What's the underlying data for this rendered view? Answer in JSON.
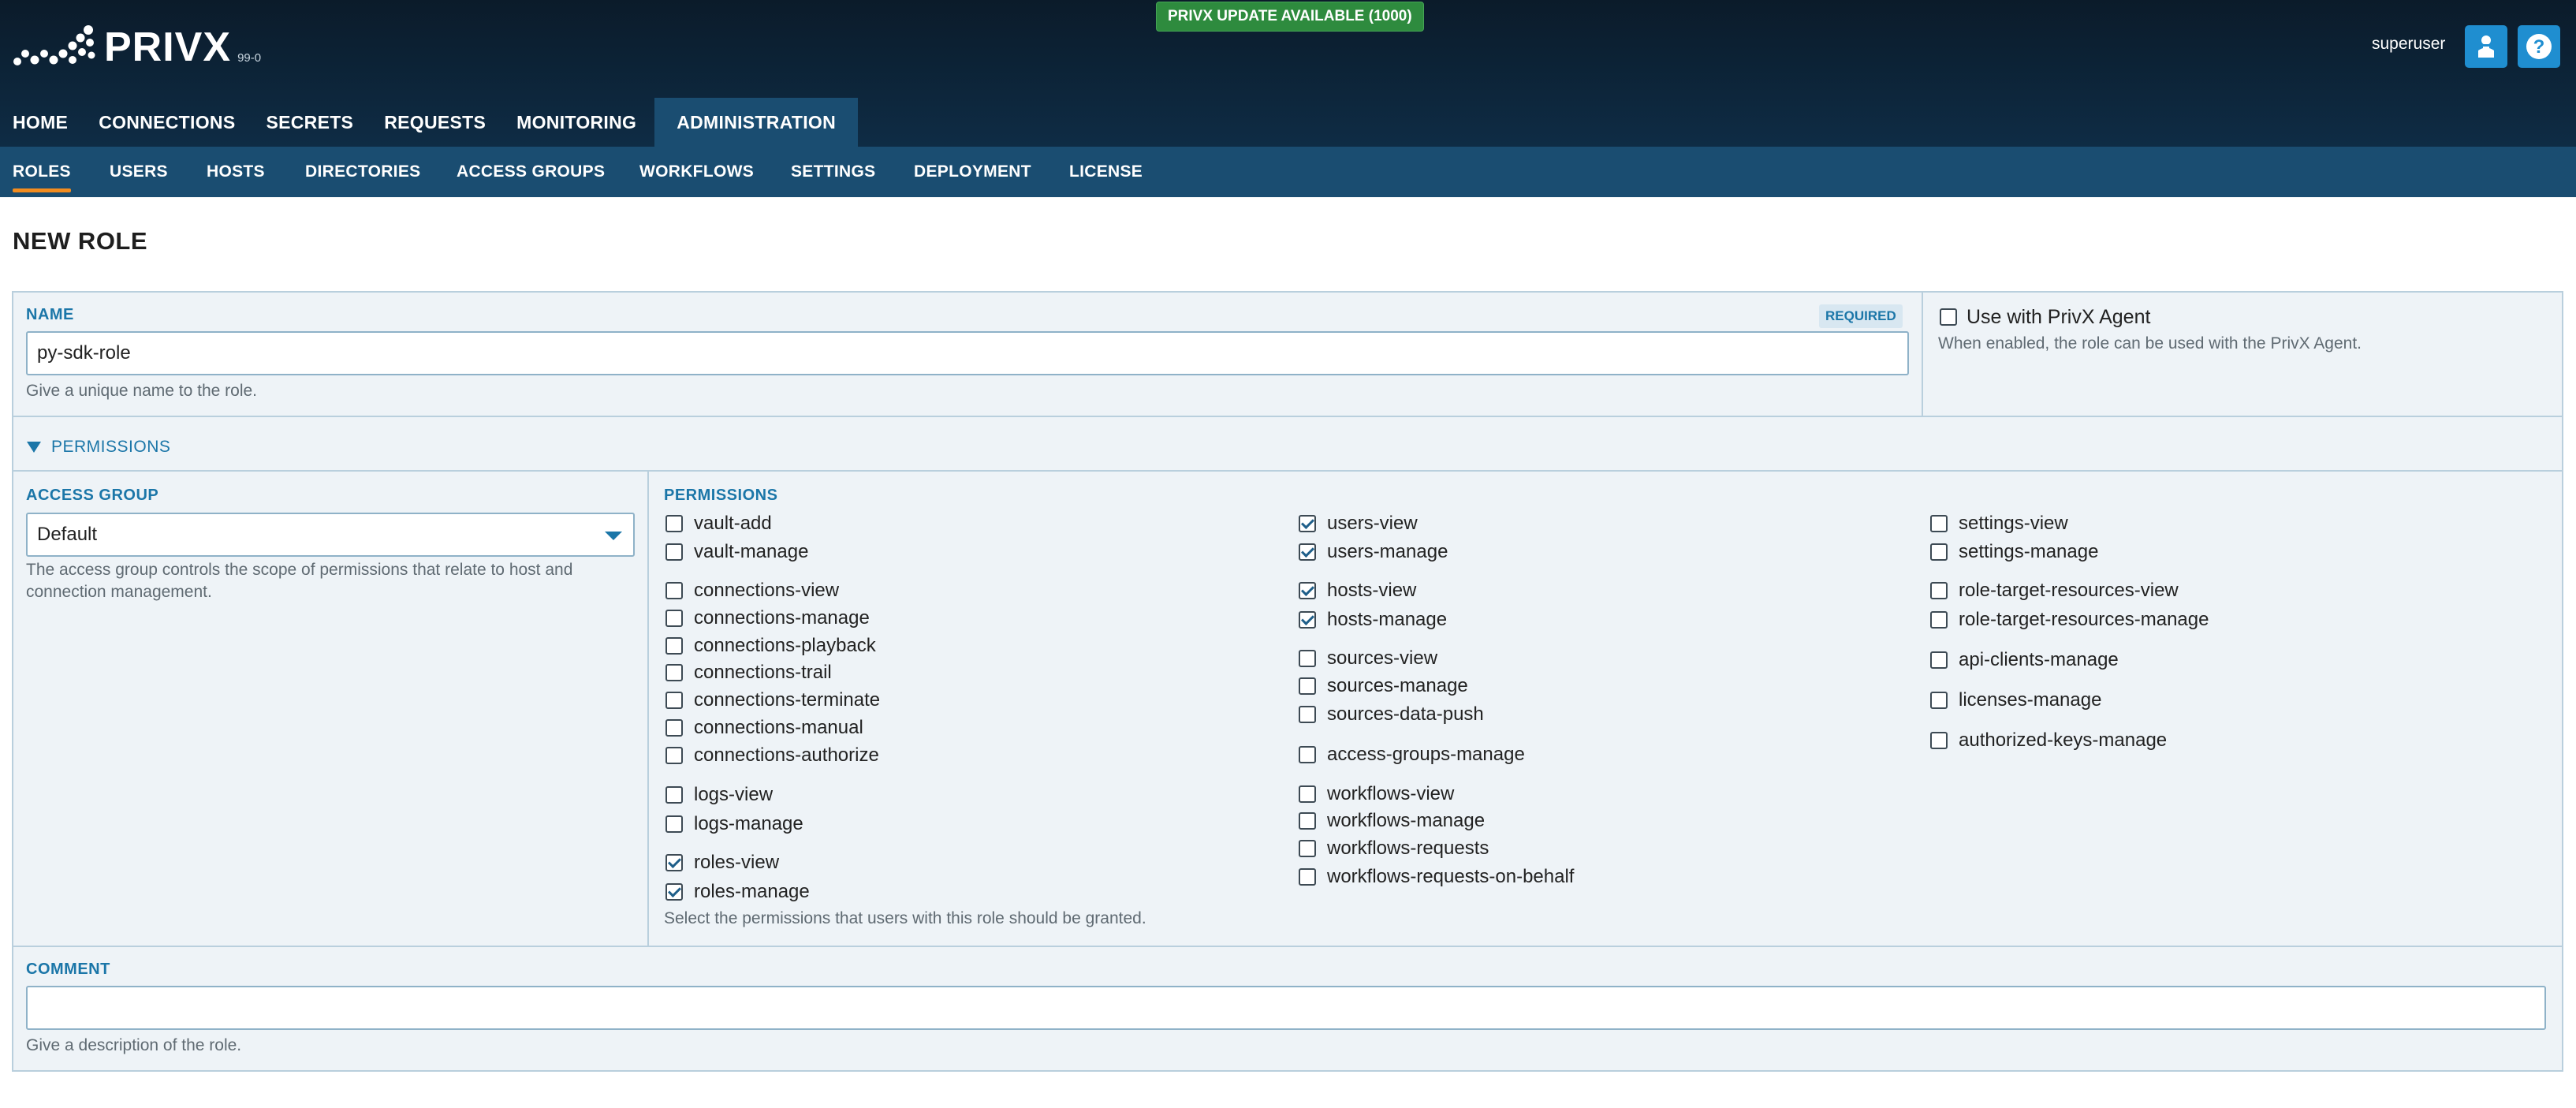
{
  "app": {
    "name": "PRIVX",
    "version": "99-0"
  },
  "update_badge": "PRIVX UPDATE AVAILABLE (1000)",
  "user": {
    "name": "superuser"
  },
  "icons": {
    "user_button": "user-icon",
    "help_button": "help-icon"
  },
  "main_nav": [
    "HOME",
    "CONNECTIONS",
    "SECRETS",
    "REQUESTS",
    "MONITORING",
    "ADMINISTRATION"
  ],
  "main_nav_active": "ADMINISTRATION",
  "sub_nav": [
    "ROLES",
    "USERS",
    "HOSTS",
    "DIRECTORIES",
    "ACCESS GROUPS",
    "WORKFLOWS",
    "SETTINGS",
    "DEPLOYMENT",
    "LICENSE"
  ],
  "sub_nav_active": "ROLES",
  "page_title": "NEW ROLE",
  "name_field": {
    "label": "NAME",
    "required": "REQUIRED",
    "value": "py-sdk-role",
    "help": "Give a unique name to the role."
  },
  "agent": {
    "label": "Use with PrivX Agent",
    "checked": false,
    "help": "When enabled, the role can be used with the PrivX Agent."
  },
  "permissions_section": "PERMISSIONS",
  "access_group": {
    "label": "ACCESS GROUP",
    "value": "Default",
    "help_line1": "The access group controls the scope of permissions that relate to host and",
    "help_line2": "connection management."
  },
  "permissions": {
    "label": "PERMISSIONS",
    "help": "Select the permissions that users with this role should be granted.",
    "col1": [
      {
        "name": "vault-add",
        "checked": false
      },
      {
        "name": "vault-manage",
        "checked": false
      },
      {
        "name": "connections-view",
        "checked": false
      },
      {
        "name": "connections-manage",
        "checked": false
      },
      {
        "name": "connections-playback",
        "checked": false
      },
      {
        "name": "connections-trail",
        "checked": false
      },
      {
        "name": "connections-terminate",
        "checked": false
      },
      {
        "name": "connections-manual",
        "checked": false
      },
      {
        "name": "connections-authorize",
        "checked": false
      },
      {
        "name": "logs-view",
        "checked": false
      },
      {
        "name": "logs-manage",
        "checked": false
      },
      {
        "name": "roles-view",
        "checked": true
      },
      {
        "name": "roles-manage",
        "checked": true
      }
    ],
    "col2": [
      {
        "name": "users-view",
        "checked": true
      },
      {
        "name": "users-manage",
        "checked": true
      },
      {
        "name": "hosts-view",
        "checked": true
      },
      {
        "name": "hosts-manage",
        "checked": true
      },
      {
        "name": "sources-view",
        "checked": false
      },
      {
        "name": "sources-manage",
        "checked": false
      },
      {
        "name": "sources-data-push",
        "checked": false
      },
      {
        "name": "access-groups-manage",
        "checked": false
      },
      {
        "name": "workflows-view",
        "checked": false
      },
      {
        "name": "workflows-manage",
        "checked": false
      },
      {
        "name": "workflows-requests",
        "checked": false
      },
      {
        "name": "workflows-requests-on-behalf",
        "checked": false
      }
    ],
    "col3": [
      {
        "name": "settings-view",
        "checked": false
      },
      {
        "name": "settings-manage",
        "checked": false
      },
      {
        "name": "role-target-resources-view",
        "checked": false
      },
      {
        "name": "role-target-resources-manage",
        "checked": false
      },
      {
        "name": "api-clients-manage",
        "checked": false
      },
      {
        "name": "licenses-manage",
        "checked": false
      },
      {
        "name": "authorized-keys-manage",
        "checked": false
      }
    ]
  },
  "comment": {
    "label": "COMMENT",
    "value": "",
    "help": "Give a description of the role."
  }
}
